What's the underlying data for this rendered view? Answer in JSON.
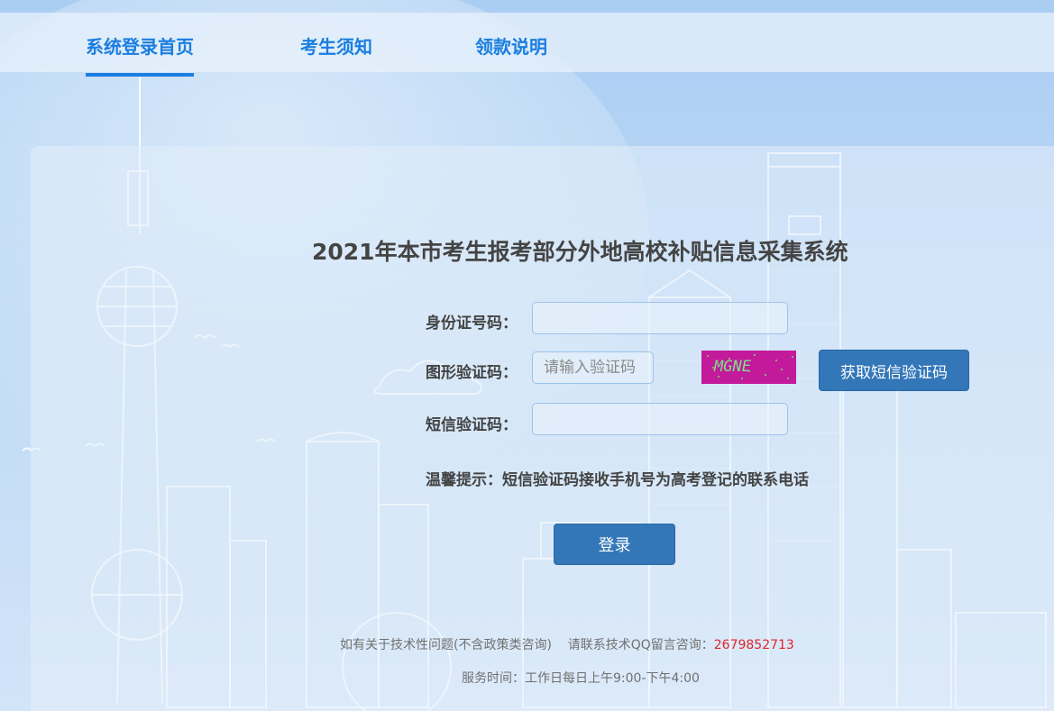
{
  "nav": {
    "items": [
      {
        "label": "系统登录首页",
        "active": true
      },
      {
        "label": "考生须知",
        "active": false
      },
      {
        "label": "领款说明",
        "active": false
      }
    ]
  },
  "form": {
    "title": "2021年本市考生报考部分外地高校补贴信息采集系统",
    "id_label": "身份证号码：",
    "id_value": "",
    "captcha_label": "图形验证码：",
    "captcha_placeholder": "请输入验证码",
    "captcha_image_text": "MGNE",
    "sms_button_label": "获取短信验证码",
    "sms_label": "短信验证码：",
    "sms_value": "",
    "tip": "温馨提示：短信验证码接收手机号为高考登记的联系电话",
    "login_label": "登录"
  },
  "footer": {
    "line1_text": "如有关于技术性问题(不含政策类咨询)    请联系技术QQ留言咨询：",
    "qq": "2679852713",
    "line2_text": "服务时间：工作日每日上午9:00-下午4:00"
  },
  "colors": {
    "accent": "#1a7ee0",
    "button": "#3377b8",
    "qq_red": "#e0242b",
    "captcha_bg": "#c21a9a",
    "captcha_text": "#7ce38a"
  },
  "icons": {
    "background": "city-skyline-illustration"
  }
}
